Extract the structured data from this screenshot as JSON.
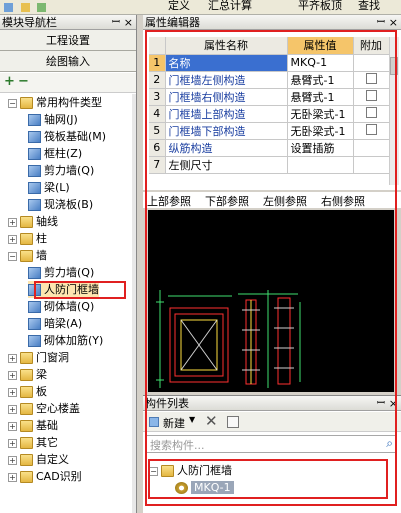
{
  "top_toolbar": {
    "items": [
      "定义",
      "汇总计算",
      "平齐板顶",
      "查找"
    ]
  },
  "nav_panel": {
    "title": "模块导航栏",
    "pin": "ꟷ",
    "close": "×",
    "buttons": [
      "工程设置",
      "绘图输入"
    ],
    "tree": [
      {
        "label": "常用构件类型",
        "expanded": true,
        "level": 1,
        "folder": true
      },
      {
        "label": "轴网(J)",
        "level": 2
      },
      {
        "label": "筏板基础(M)",
        "level": 2
      },
      {
        "label": "框柱(Z)",
        "level": 2
      },
      {
        "label": "剪力墙(Q)",
        "level": 2
      },
      {
        "label": "梁(L)",
        "level": 2
      },
      {
        "label": "现浇板(B)",
        "level": 2
      },
      {
        "label": "轴线",
        "level": 1,
        "folder": true
      },
      {
        "label": "柱",
        "level": 1,
        "folder": true
      },
      {
        "label": "墙",
        "expanded": true,
        "level": 1,
        "folder": true
      },
      {
        "label": "剪力墙(Q)",
        "level": 2
      },
      {
        "label": "人防门框墙",
        "level": 2,
        "selected": true
      },
      {
        "label": "砌体墙(Q)",
        "level": 2
      },
      {
        "label": "暗梁(A)",
        "level": 2
      },
      {
        "label": "砌体加筋(Y)",
        "level": 2
      },
      {
        "label": "门窗洞",
        "level": 1,
        "folder": true
      },
      {
        "label": "梁",
        "level": 1,
        "folder": true
      },
      {
        "label": "板",
        "level": 1,
        "folder": true
      },
      {
        "label": "空心楼盖",
        "level": 1,
        "folder": true
      },
      {
        "label": "基础",
        "level": 1,
        "folder": true
      },
      {
        "label": "其它",
        "level": 1,
        "folder": true
      },
      {
        "label": "自定义",
        "level": 1,
        "folder": true
      },
      {
        "label": "CAD识别",
        "level": 1,
        "folder": true
      }
    ]
  },
  "prop_panel": {
    "title": "属性编辑器",
    "columns": [
      "属性名称",
      "属性值",
      "附加"
    ],
    "rows": [
      {
        "num": "1",
        "name": "名称",
        "value": "MKQ-1",
        "check": false
      },
      {
        "num": "2",
        "name": "门框墙左侧构造",
        "value": "悬臂式-1",
        "check": true
      },
      {
        "num": "3",
        "name": "门框墙右侧构造",
        "value": "悬臂式-1",
        "check": true
      },
      {
        "num": "4",
        "name": "门框墙上部构造",
        "value": "无卧梁式-1",
        "check": true
      },
      {
        "num": "5",
        "name": "门框墙下部构造",
        "value": "无卧梁式-1",
        "check": true
      },
      {
        "num": "6",
        "name": "纵筋构造",
        "value": "设置插筋",
        "check": false
      },
      {
        "num": "7",
        "name": "左侧尺寸",
        "value": "",
        "check": false
      }
    ],
    "views": [
      "上部参照",
      "下部参照",
      "左侧参照",
      "右侧参照"
    ]
  },
  "comp_panel": {
    "title": "构件列表",
    "new_label": "新建",
    "search_placeholder": "搜索构件...",
    "tree": {
      "parent": "人防门框墙",
      "child": "MKQ-1"
    }
  }
}
